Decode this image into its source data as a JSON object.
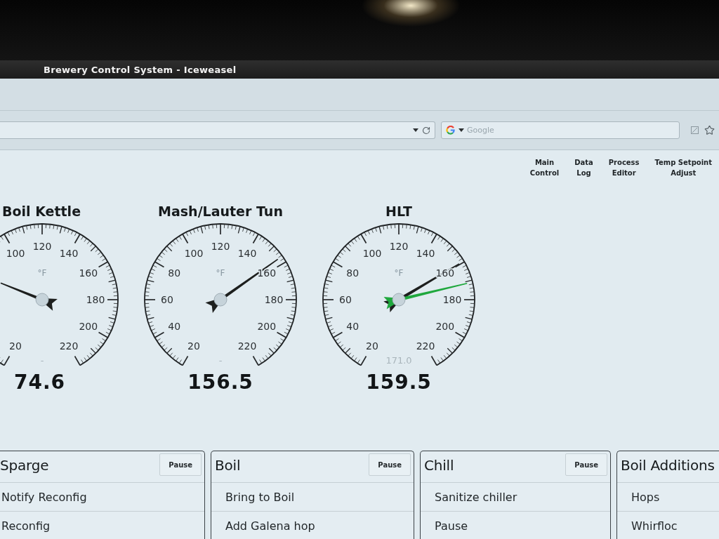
{
  "window": {
    "title": "Brewery Control System - Iceweasel"
  },
  "search": {
    "placeholder": "Google"
  },
  "nav": [
    {
      "lines": [
        "Main",
        "Control"
      ]
    },
    {
      "lines": [
        "Data",
        "Log"
      ]
    },
    {
      "lines": [
        "Process",
        "Editor"
      ]
    },
    {
      "lines": [
        "Temp Setpoint",
        "Adjust"
      ]
    }
  ],
  "gauges": [
    {
      "title": "Boil Kettle",
      "unit": "°F",
      "ticks": [
        "20",
        "100",
        "120",
        "140",
        "160",
        "180",
        "200",
        "220"
      ],
      "setpoint": "-",
      "value": "74.6"
    },
    {
      "title": "Mash/Lauter Tun",
      "unit": "°F",
      "ticks": [
        "20",
        "40",
        "60",
        "80",
        "100",
        "120",
        "140",
        "160",
        "180",
        "200",
        "220"
      ],
      "setpoint": "-",
      "value": "156.5"
    },
    {
      "title": "HLT",
      "unit": "°F",
      "ticks": [
        "20",
        "40",
        "60",
        "80",
        "100",
        "120",
        "140",
        "160",
        "180",
        "200",
        "220"
      ],
      "setpoint": "171.0",
      "value": "159.5"
    }
  ],
  "panels": [
    {
      "title": "Sparge",
      "pause": "Pause",
      "steps": [
        "Notify Reconfig",
        "Reconfig"
      ]
    },
    {
      "title": "Boil",
      "pause": "Pause",
      "steps": [
        "Bring to Boil",
        "Add Galena hop"
      ]
    },
    {
      "title": "Chill",
      "pause": "Pause",
      "steps": [
        "Sanitize chiller",
        "Pause"
      ]
    },
    {
      "title": "Boil Additions",
      "steps": [
        "Hops",
        "Whirfloc"
      ]
    }
  ]
}
